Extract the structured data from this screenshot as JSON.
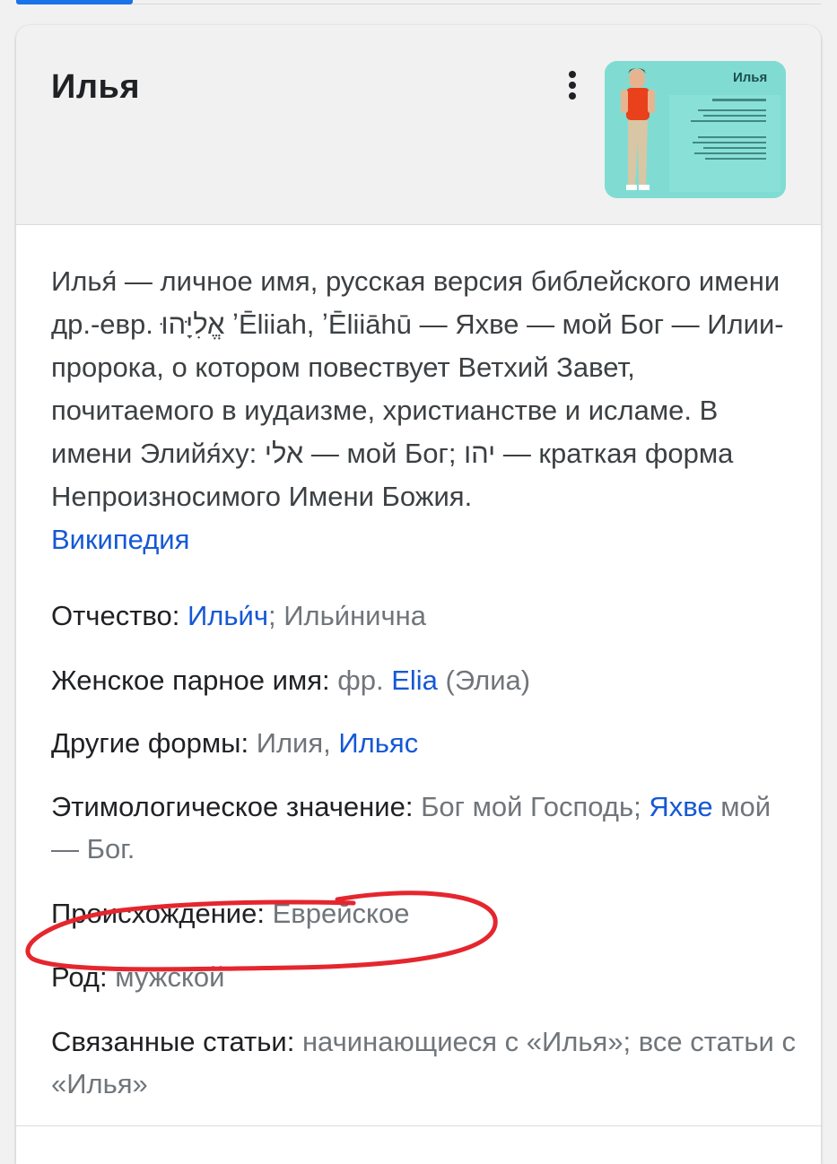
{
  "card": {
    "title": "Илья",
    "thumbnail_title": "Илья"
  },
  "description": {
    "text": "Илья́ — личное имя, русская версия библейского имени др.-евр. אֱלִיָּהוּ ʼĒliiah, ʼĒliiāhū — Яхве — мой Бог — Илии-пророка, о котором повествует Ветхий Завет, почитаемого в иудаизме, христианстве и исламе. В имени Элийя́ху: אלי — мой Бог; יהו — краткая форма Непроизносимого Имени Божия.",
    "source_link": "Википедия"
  },
  "facts": [
    {
      "label": "Отчество",
      "parts": [
        {
          "text": "Ильи́ч",
          "link": true
        },
        {
          "text": "; Ильи́нична",
          "link": false
        }
      ]
    },
    {
      "label": "Женское парное имя",
      "parts": [
        {
          "text": "фр. ",
          "link": false
        },
        {
          "text": "Elia",
          "link": true
        },
        {
          "text": " (Элиа)",
          "link": false
        }
      ]
    },
    {
      "label": "Другие формы",
      "parts": [
        {
          "text": "Илия, ",
          "link": false
        },
        {
          "text": "Ильяс",
          "link": true
        }
      ]
    },
    {
      "label": "Этимологическое значение",
      "parts": [
        {
          "text": "Бог мой Господь; ",
          "link": false
        },
        {
          "text": "Яхве",
          "link": true
        },
        {
          "text": " мой — Бог.",
          "link": false
        }
      ]
    },
    {
      "label": "Происхождение",
      "parts": [
        {
          "text": "Еврейское",
          "link": false
        }
      ]
    },
    {
      "label": "Род",
      "parts": [
        {
          "text": "мужской",
          "link": false
        }
      ]
    },
    {
      "label": "Связанные статьи",
      "parts": [
        {
          "text": "начинающиеся с «Илья»; все статьи с «Илья»",
          "link": false
        }
      ]
    }
  ],
  "colors": {
    "link": "#1558d6",
    "annotation_circle": "#e5262e",
    "thumbnail_bg": "#7fdcd2"
  },
  "icons": {
    "more": "more-vert-icon"
  }
}
